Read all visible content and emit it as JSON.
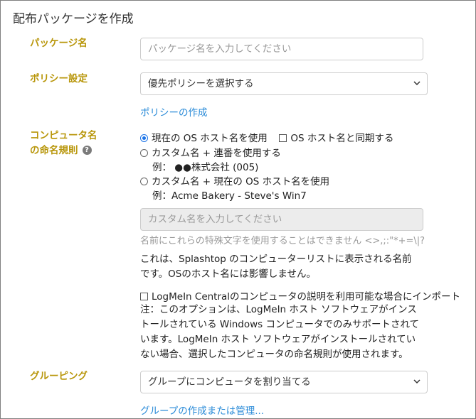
{
  "title": "配布パッケージを作成",
  "package": {
    "label": "パッケージ名",
    "placeholder": "パッケージ名を入力してください"
  },
  "policy": {
    "label": "ポリシー設定",
    "selected": "優先ポリシーを選択する",
    "create_link": "ポリシーの作成"
  },
  "naming": {
    "label_line1": "コンピュータ名",
    "label_line2": "の命名規則",
    "help_icon": "question-circle-icon",
    "option1": "現在の OS ホスト名を使用",
    "option1_checked": true,
    "sync_checkbox": "OS ホスト名と同期する",
    "sync_checked": false,
    "option2": "カスタム名 + 連番を使用する",
    "option2_example": "例： ●●株式会社 (005)",
    "option3": "カスタム名 + 現在の OS ホスト名を使用",
    "option3_example": "例：Acme Bakery - Steve's Win7",
    "custom_placeholder": "カスタム名を入力してください",
    "invalid_chars_hint": "名前にこれらの特殊文字を使用することはできません <>,;:\"*+=\\|?",
    "description_line1": "これは、Splashtop のコンピューターリストに表示される名前",
    "description_line2": "です。OSのホスト名には影響しません。",
    "import_checkbox": "LogMeIn Centralのコンピュータの説明を利用可能な場合にインポート",
    "import_checked": false,
    "note_line1": "注：このオプションは、LogMeIn ホスト ソフトウェアがインス",
    "note_line2": "トールされている Windows コンピュータでのみサポートされて",
    "note_line3": "います。LogMeIn ホスト ソフトウェアがインストールされてい",
    "note_line4": "ない場合、選択したコンピュータの命名規則が使用されます。"
  },
  "grouping": {
    "label": "グルーピング",
    "selected": "グループにコンピュータを割り当てる",
    "manage_link": "グループの作成または管理..."
  },
  "colors": {
    "label": "#b8960a",
    "link": "#2a8bd8",
    "radio_selected": "#1a73e8"
  }
}
